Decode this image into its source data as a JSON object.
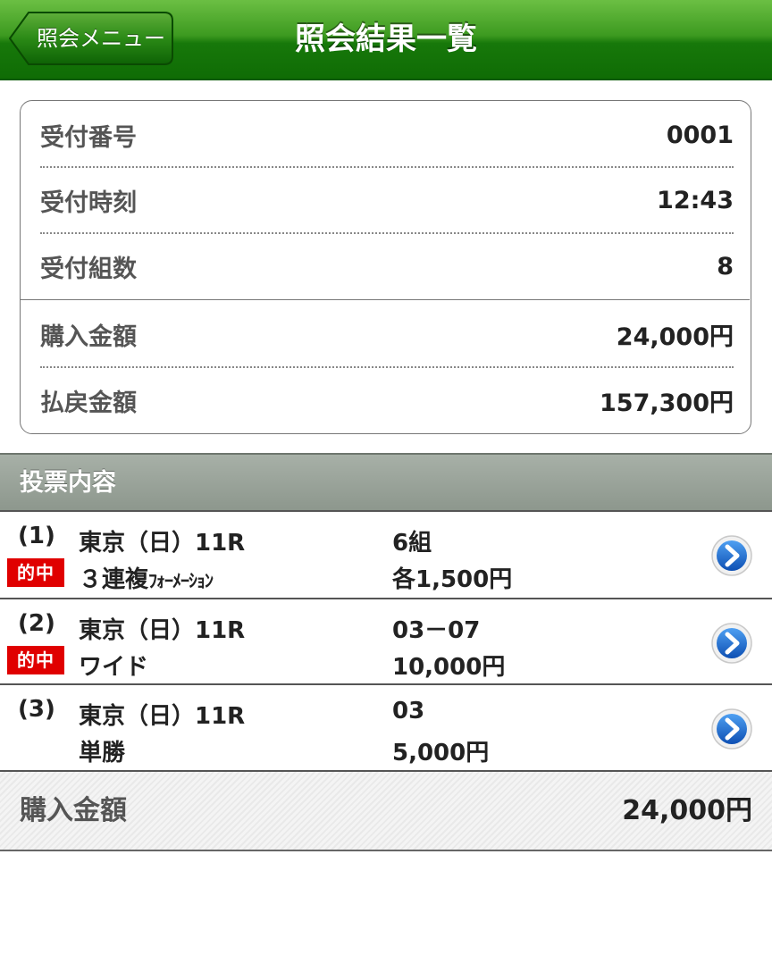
{
  "header": {
    "back_label": "照会メニュー",
    "title": "照会結果一覧"
  },
  "summary": {
    "receipt_number_label": "受付番号",
    "receipt_number": "0001",
    "receipt_time_label": "受付時刻",
    "receipt_time": "12:43",
    "receipt_count_label": "受付組数",
    "receipt_count": "8",
    "purchase_amount_label": "購入金額",
    "purchase_amount": "24,000円",
    "payout_amount_label": "払戻金額",
    "payout_amount": "157,300円"
  },
  "section": {
    "title": "投票内容"
  },
  "bets": [
    {
      "number": "(1)",
      "hit_label": "的中",
      "venue": "東京（日）11R",
      "bet_type_main": "３連複",
      "bet_type_small": "ﾌｫｰﾒｰｼｮﾝ",
      "combination": "6組",
      "amount": "各1,500円"
    },
    {
      "number": "(2)",
      "hit_label": "的中",
      "venue": "東京（日）11R",
      "bet_type": "ワイド",
      "combination": "03－07",
      "amount": "10,000円"
    },
    {
      "number": "(3)",
      "venue": "東京（日）11R",
      "bet_type": "単勝",
      "combination": "03",
      "amount": "5,000円"
    }
  ],
  "total": {
    "label": "購入金額",
    "value": "24,000円"
  },
  "colors": {
    "header_green": "#17780a",
    "hit_red": "#e00000",
    "arrow_blue": "#1a6fd6",
    "section_gray": "#8d978d"
  },
  "icons": {
    "back": "chevron-left-icon",
    "detail": "chevron-right-circle-icon"
  }
}
